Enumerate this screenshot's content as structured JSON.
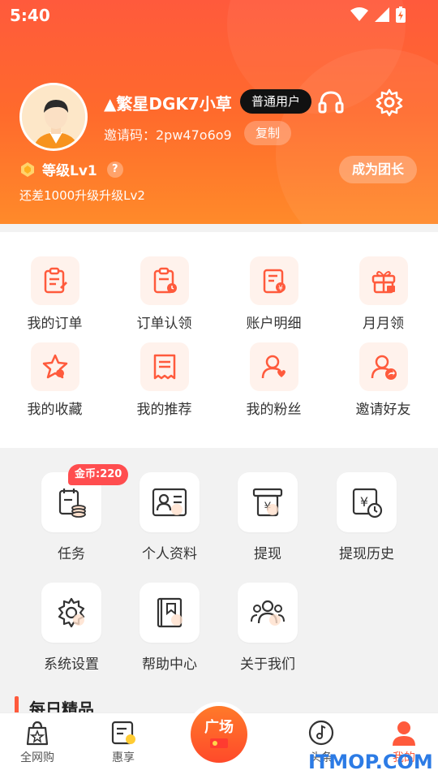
{
  "status_bar": {
    "time": "5:40"
  },
  "profile": {
    "username": "▲繁星DGK7小草",
    "user_type": "普通用户",
    "invite_label": "邀请码：2pw47o6o9",
    "copy_label": "复制",
    "level": "等级Lv1",
    "help": "?",
    "upgrade_hint": "还差1000升级升级Lv2",
    "leader_button": "成为团长"
  },
  "menu": {
    "row1": [
      {
        "label": "我的订单",
        "icon": "order-icon"
      },
      {
        "label": "订单认领",
        "icon": "order-claim-icon"
      },
      {
        "label": "账户明细",
        "icon": "account-detail-icon"
      },
      {
        "label": "月月领",
        "icon": "gift-icon"
      }
    ],
    "row2": [
      {
        "label": "我的收藏",
        "icon": "favorite-icon"
      },
      {
        "label": "我的推荐",
        "icon": "recommend-icon"
      },
      {
        "label": "我的粉丝",
        "icon": "fans-icon"
      },
      {
        "label": "邀请好友",
        "icon": "invite-icon"
      }
    ]
  },
  "tools": {
    "coin_badge": "金币:220",
    "items": [
      {
        "label": "任务",
        "icon": "task-icon"
      },
      {
        "label": "个人资料",
        "icon": "profile-card-icon"
      },
      {
        "label": "提现",
        "icon": "withdraw-icon"
      },
      {
        "label": "提现历史",
        "icon": "withdraw-history-icon"
      },
      {
        "label": "系统设置",
        "icon": "gear-icon"
      },
      {
        "label": "帮助中心",
        "icon": "help-book-icon"
      },
      {
        "label": "关于我们",
        "icon": "team-icon"
      }
    ]
  },
  "daily": {
    "title": "每日精品"
  },
  "nav": {
    "items": [
      {
        "label": "全网购"
      },
      {
        "label": "惠享"
      },
      {
        "label": "广场"
      },
      {
        "label": "头条"
      },
      {
        "label": "我的"
      }
    ]
  },
  "watermark": "ITMOP.COM",
  "colors": {
    "accent": "#ff5a3c",
    "icon_bg": "#fff2ec",
    "badge": "#ff4d4f"
  }
}
